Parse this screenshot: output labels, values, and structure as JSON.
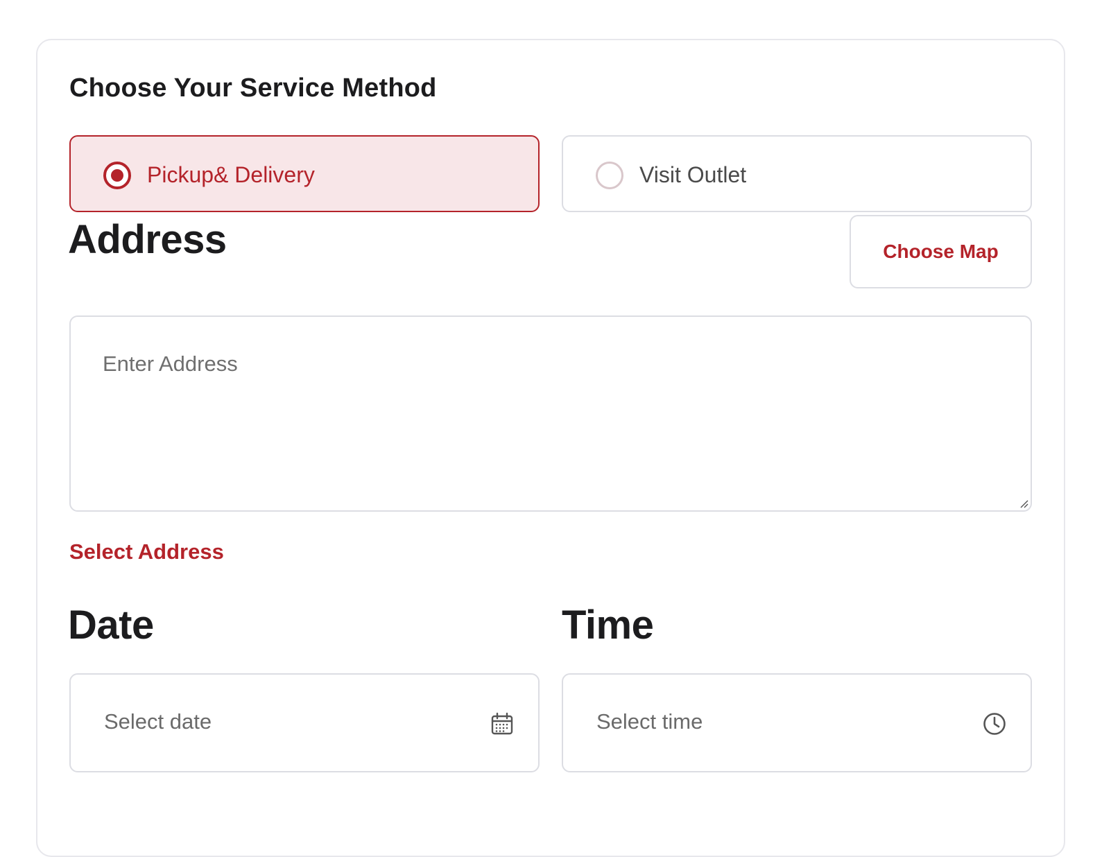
{
  "service_method": {
    "title": "Choose Your Service Method",
    "options": [
      {
        "label": "Pickup& Delivery",
        "selected": true
      },
      {
        "label": "Visit Outlet",
        "selected": false
      }
    ]
  },
  "address": {
    "label": "Address",
    "choose_map_label": "Choose Map",
    "placeholder": "Enter Address",
    "select_address_link": "Select Address"
  },
  "date": {
    "label": "Date",
    "placeholder": "Select date",
    "icon": "calendar-icon"
  },
  "time": {
    "label": "Time",
    "placeholder": "Select time",
    "icon": "clock-icon"
  },
  "colors": {
    "accent": "#b4232a",
    "selected_bg": "#f8e6e8",
    "border": "#dcdde3"
  }
}
